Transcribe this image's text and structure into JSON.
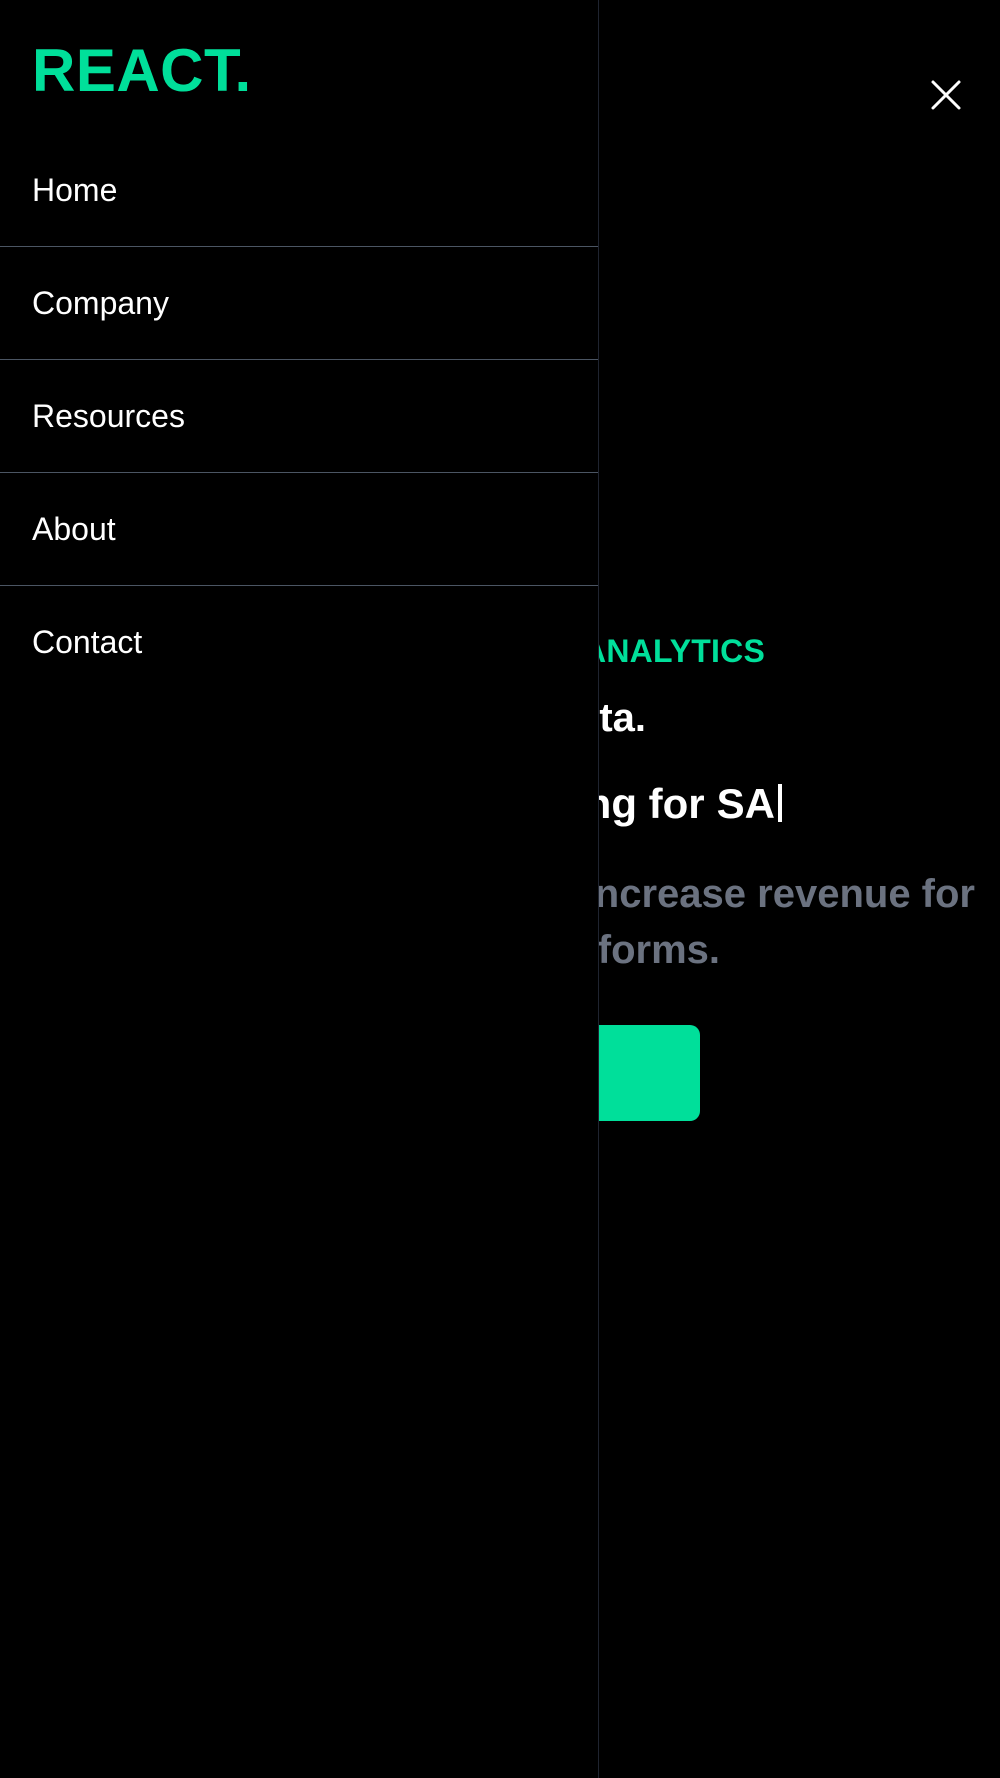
{
  "brand": {
    "logo_text": "REACT.",
    "accent_color": "#00df9a"
  },
  "nav": {
    "items": [
      {
        "label": "Home"
      },
      {
        "label": "Company"
      },
      {
        "label": "Resources"
      },
      {
        "label": "About"
      },
      {
        "label": "Contact"
      }
    ]
  },
  "hero": {
    "eyebrow": "ANALYTICS",
    "title": "ta.",
    "typing_prefix": "ng for",
    "typing_word": "SA",
    "desc_line1": "increase revenue for",
    "desc_line2": "latforms.",
    "cta_label": ""
  },
  "controls": {
    "close_icon": "close-icon"
  },
  "colors": {
    "background": "#000000",
    "text": "#ffffff",
    "muted": "#6b7280",
    "divider": "#4b5563"
  }
}
